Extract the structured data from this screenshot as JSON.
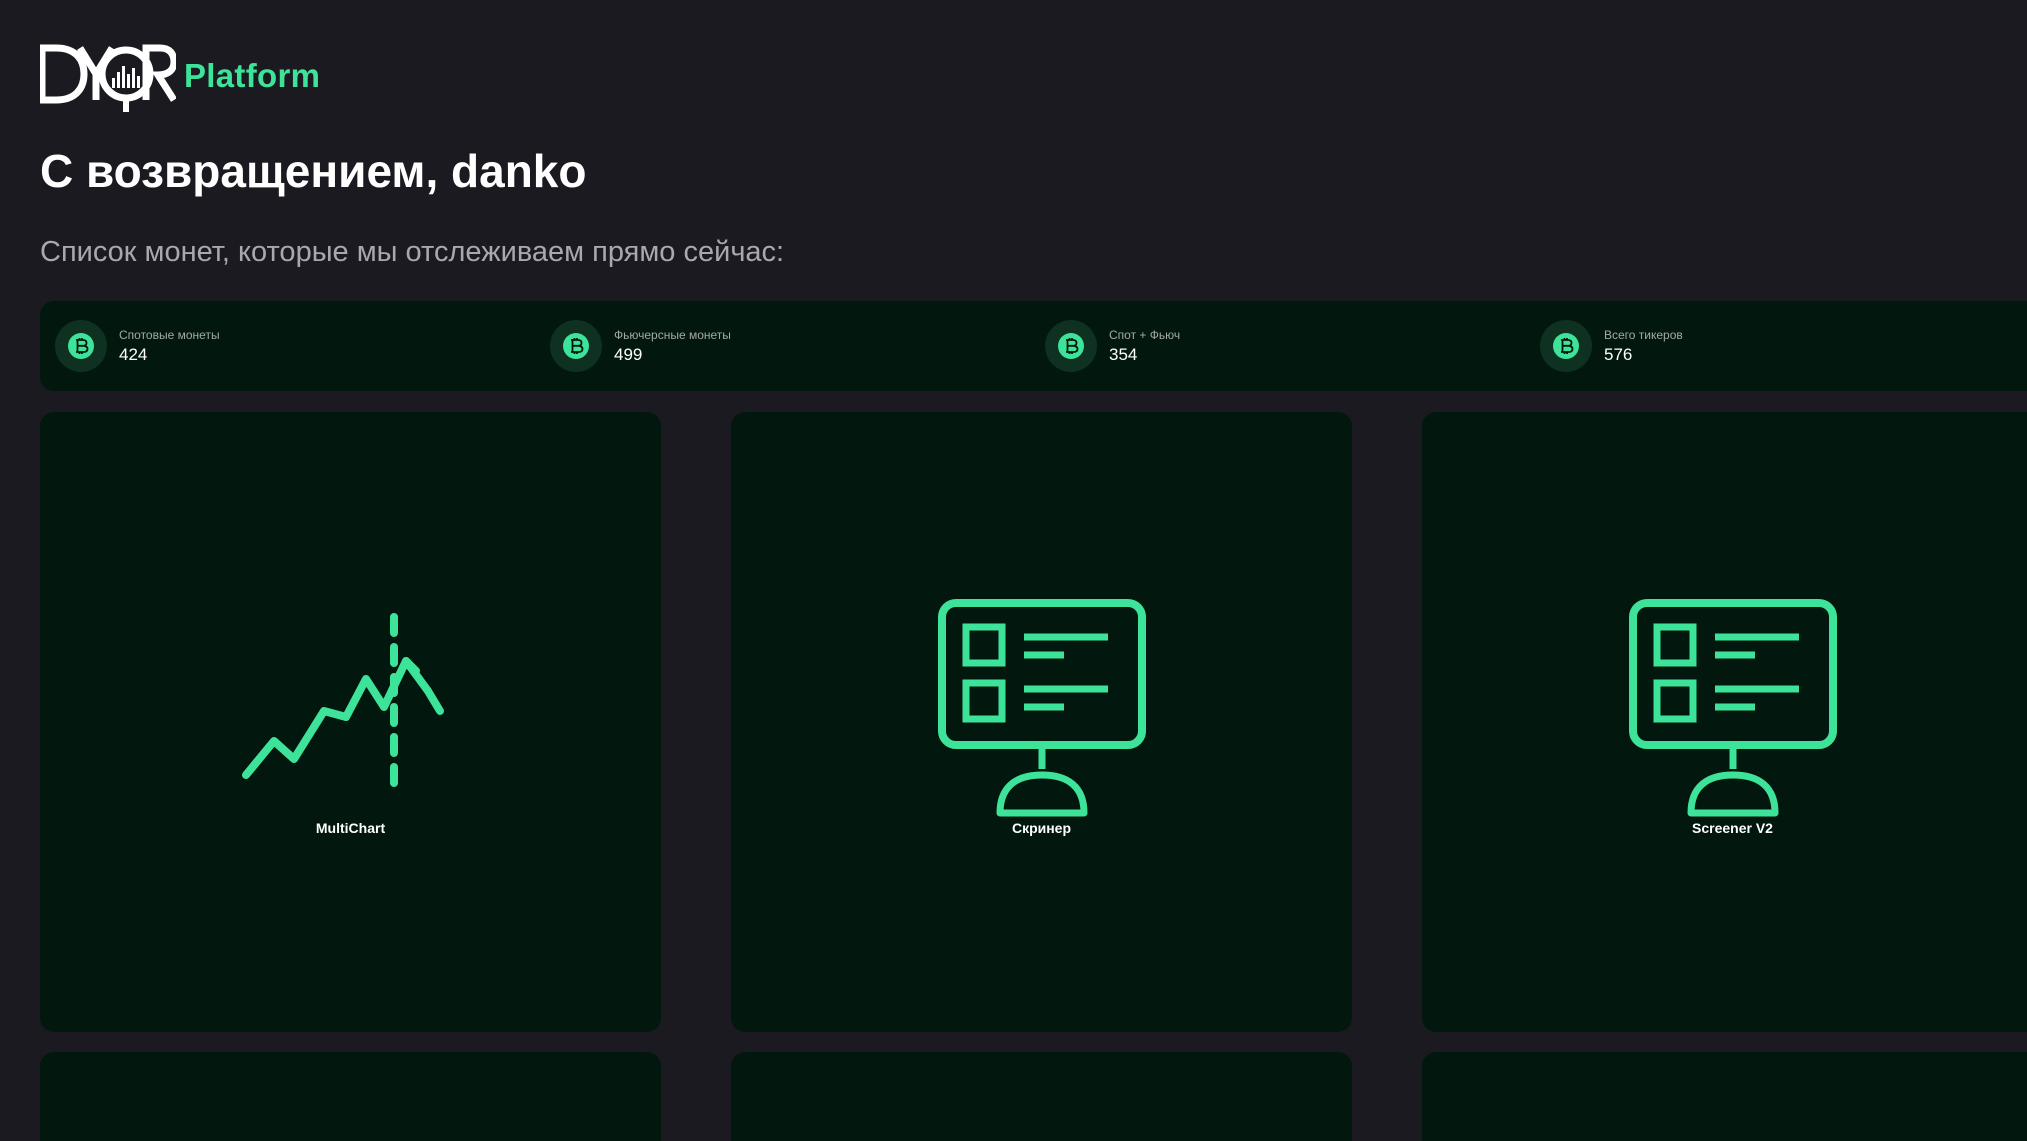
{
  "brand": {
    "logo_text": "DYOR",
    "platform_label": "Platform",
    "accent_color": "#3ee39a"
  },
  "greeting": {
    "title": "С возвращением, danko",
    "subtitle": "Список монет, которые мы отслеживаем прямо сейчас:"
  },
  "stats": [
    {
      "icon": "bitcoin-icon",
      "label": "Спотовые монеты",
      "value": "424"
    },
    {
      "icon": "bitcoin-icon",
      "label": "Фьючерсные монеты",
      "value": "499"
    },
    {
      "icon": "bitcoin-icon",
      "label": "Спот + Фьюч",
      "value": "354"
    },
    {
      "icon": "bitcoin-icon",
      "label": "Всего тикеров",
      "value": "576"
    }
  ],
  "cards": [
    {
      "icon": "chart-line-icon",
      "title": "MultiChart"
    },
    {
      "icon": "monitor-icon",
      "title": "Скринер"
    },
    {
      "icon": "monitor-icon",
      "title": "Screener V2"
    }
  ],
  "colors": {
    "background": "#1a1a20",
    "panel": "#02180f",
    "accent": "#3ee39a",
    "icon_circle": "#0e3121"
  }
}
